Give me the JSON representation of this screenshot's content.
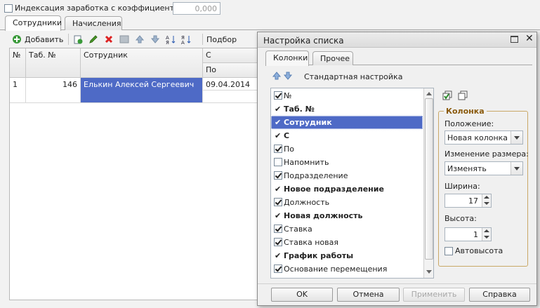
{
  "top": {
    "index_checkbox_label": "Индексация заработка с коэффициентом:",
    "coefficient_value": "0,000"
  },
  "tabs": [
    {
      "label": "Сотрудники",
      "active": true
    },
    {
      "label": "Начисления",
      "active": false
    }
  ],
  "toolbar": {
    "add_label": "Добавить",
    "pick_label": "Подбор",
    "icons": [
      "add-icon",
      "copy-icon",
      "edit-icon",
      "delete-icon",
      "save-icon",
      "move-up-icon",
      "move-down-icon",
      "sort-asc-icon",
      "sort-desc-icon"
    ]
  },
  "table": {
    "headers": {
      "num": "№",
      "tab": "Таб. №",
      "employee": "Сотрудник",
      "from": "С",
      "to": "По"
    },
    "rows": [
      {
        "num": "1",
        "tab": "146",
        "employee": "Елькин Алексей Сергеевич",
        "from": "09.04.2014"
      }
    ]
  },
  "dialog": {
    "title": "Настройка списка",
    "tabs": [
      "Колонки",
      "Прочее"
    ],
    "standard_setting": "Стандартная настройка",
    "columns_list": [
      {
        "label": "№",
        "mark": "check",
        "bold": false,
        "selected": false
      },
      {
        "label": "Таб. №",
        "mark": "tick",
        "bold": true,
        "selected": false
      },
      {
        "label": "Сотрудник",
        "mark": "tick",
        "bold": true,
        "selected": true
      },
      {
        "label": "С",
        "mark": "tick",
        "bold": true,
        "selected": false
      },
      {
        "label": "По",
        "mark": "check",
        "bold": false,
        "selected": false
      },
      {
        "label": "Напомнить",
        "mark": "empty",
        "bold": false,
        "selected": false
      },
      {
        "label": "Подразделение",
        "mark": "check",
        "bold": false,
        "selected": false
      },
      {
        "label": "Новое подразделение",
        "mark": "tick",
        "bold": true,
        "selected": false
      },
      {
        "label": "Должность",
        "mark": "check",
        "bold": false,
        "selected": false
      },
      {
        "label": "Новая должность",
        "mark": "tick",
        "bold": true,
        "selected": false
      },
      {
        "label": "Ставка",
        "mark": "check",
        "bold": false,
        "selected": false
      },
      {
        "label": "Ставка новая",
        "mark": "check",
        "bold": false,
        "selected": false
      },
      {
        "label": "График работы",
        "mark": "tick",
        "bold": true,
        "selected": false
      },
      {
        "label": "Основание перемещения",
        "mark": "check",
        "bold": false,
        "selected": false
      }
    ],
    "column_group": {
      "title": "Колонка",
      "position_label": "Положение:",
      "position_value": "Новая колонка",
      "resize_label": "Изменение размера:",
      "resize_value": "Изменять",
      "width_label": "Ширина:",
      "width_value": "17",
      "height_label": "Высота:",
      "height_value": "1",
      "autoheight_label": "Автовысота"
    },
    "buttons": {
      "ok": "OK",
      "cancel": "Отмена",
      "apply": "Применить",
      "help": "Справка"
    }
  },
  "colors": {
    "selection": "#4e6ac6",
    "group_title": "#8a5a0c",
    "dialog_bg": "#f0f0f0"
  }
}
